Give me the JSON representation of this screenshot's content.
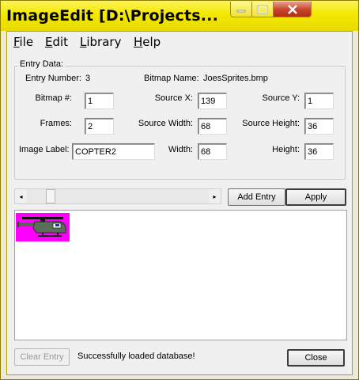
{
  "window": {
    "title": "ImageEdit [D:\\Projects...",
    "colors": {
      "titlebar": "#f3e800",
      "sprite_background": "#ff00ff"
    }
  },
  "titlebar_buttons": {
    "minimize_icon": "minimize-icon",
    "maximize_icon": "maximize-icon",
    "close_icon": "close-icon"
  },
  "menu": {
    "items": [
      {
        "label": "File",
        "key": "F"
      },
      {
        "label": "Edit",
        "key": "E"
      },
      {
        "label": "Library",
        "key": "L"
      },
      {
        "label": "Help",
        "key": "H"
      }
    ]
  },
  "entry_data": {
    "group_label": "Entry Data:",
    "entry_number_label": "Entry Number:",
    "entry_number_value": "3",
    "bitmap_name_label": "Bitmap Name:",
    "bitmap_name_value": "JoesSprites.bmp",
    "bitmap_num_label": "Bitmap #:",
    "bitmap_num_value": "1",
    "source_x_label": "Source X:",
    "source_x_value": "139",
    "source_y_label": "Source Y:",
    "source_y_value": "1",
    "frames_label": "Frames:",
    "frames_value": "2",
    "source_width_label": "Source Width:",
    "source_width_value": "68",
    "source_height_label": "Source Height:",
    "source_height_value": "36",
    "image_label_label": "Image Label:",
    "image_label_value": "COPTER2",
    "width_label": "Width:",
    "width_value": "68",
    "height_label": "Height:",
    "height_value": "36"
  },
  "scrollbar": {
    "left_arrow": "◂",
    "right_arrow": "▸"
  },
  "buttons": {
    "add_entry": "Add Entry",
    "apply": "Apply",
    "clear_entry": "Clear Entry",
    "close": "Close"
  },
  "status": {
    "message": "Successfully loaded database!"
  }
}
